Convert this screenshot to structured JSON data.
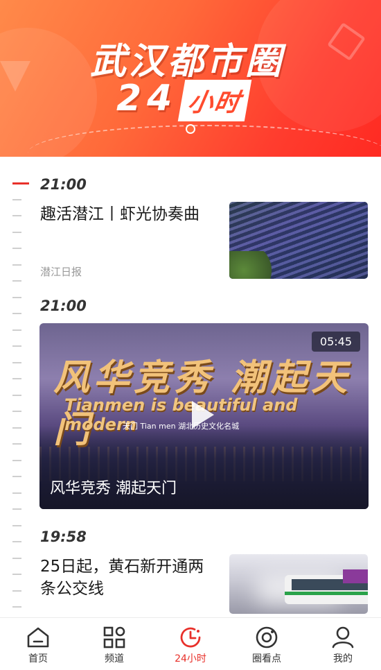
{
  "banner": {
    "title_line1": "武汉都市圈",
    "title_line2_num": "24",
    "title_line2_box": "小时"
  },
  "news": [
    {
      "time": "21:00",
      "title": "趣活潜江丨虾光协奏曲",
      "source": "潜江日报",
      "type": "article"
    },
    {
      "time": "21:00",
      "title": "风华竞秀 潮起天门",
      "type": "video",
      "duration": "05:45",
      "video_overlay_text": "风华竞秀 潮起天门",
      "video_overlay_subtext": "Tianmen is beautiful and modern",
      "video_tag": "天门 Tian men 湖北历史文化名城"
    },
    {
      "time": "19:58",
      "title": "25日起，黄石新开通两条公交线",
      "type": "article"
    }
  ],
  "tabbar": {
    "items": [
      {
        "label": "首页",
        "icon": "home-icon",
        "active": false
      },
      {
        "label": "频道",
        "icon": "channel-grid-icon",
        "active": false
      },
      {
        "label": "24小时",
        "icon": "clock-icon",
        "active": true
      },
      {
        "label": "圈看点",
        "icon": "circle-view-icon",
        "active": false
      },
      {
        "label": "我的",
        "icon": "user-icon",
        "active": false
      }
    ]
  },
  "colors": {
    "accent": "#e8302a",
    "banner_start": "#ff8a4a",
    "banner_end": "#ff2a22"
  }
}
